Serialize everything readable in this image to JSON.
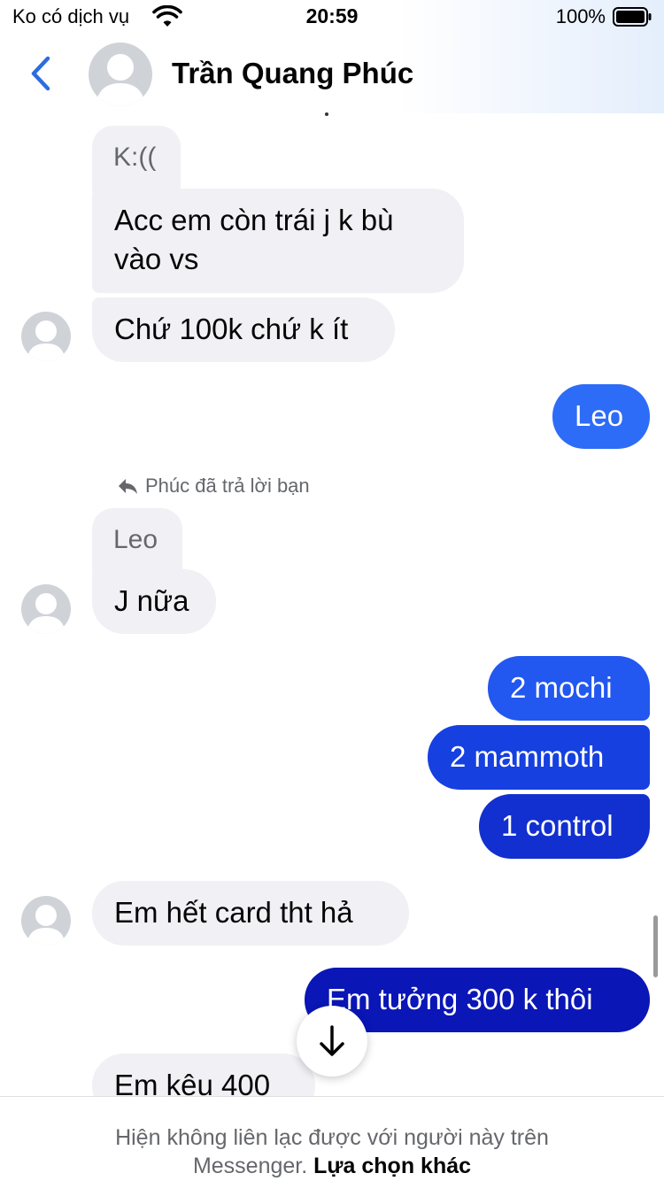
{
  "status_bar": {
    "carrier": "Ko có dịch vụ",
    "time": "20:59",
    "battery": "100%"
  },
  "header": {
    "contact_name": "Trần Quang Phúc",
    "accent_color": "#2d6cdf"
  },
  "messages": {
    "m1": "K:((",
    "m2_line1": "Acc em còn trái j k bù",
    "m2_line2": "vào vs",
    "m3": "Chứ 100k chứ k ít",
    "m4": "Leo",
    "reply_note": "Phúc đã trả lời bạn",
    "m5_quote": "Leo",
    "m6": "J nữa",
    "m7": "2 mochi",
    "m8": "2 mammoth",
    "m9": "1 control",
    "m10": "Em hết card tht hả",
    "m11": "Em tưởng 300 k thôi",
    "m12": "Em kêu 400"
  },
  "colors": {
    "incoming_bubble": "#f0f0f5",
    "outgoing_top": "#2d6cf6",
    "outgoing_mid": "#1640e0",
    "outgoing_bottom": "#0a16b6"
  },
  "footer": {
    "line1": "Hiện không liên lạc được với người này trên",
    "line2_prefix": "Messenger.",
    "line2_link": "Lựa chọn khác"
  }
}
